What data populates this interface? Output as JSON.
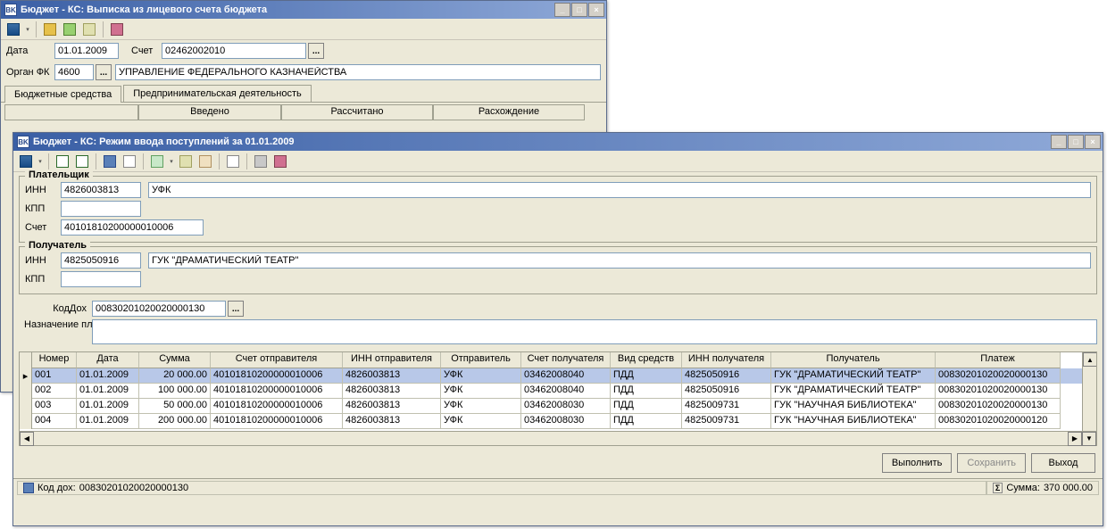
{
  "win1": {
    "title": "Бюджет - КС: Выписка из лицевого счета бюджета",
    "labels": {
      "date": "Дата",
      "account": "Счет",
      "organfk": "Орган ФК"
    },
    "date": "01.01.2009",
    "account": "02462002010",
    "organfk_code": "4600",
    "organfk_name": "УПРАВЛЕНИЕ ФЕДЕРАЛЬНОГО КАЗНАЧЕЙСТВА",
    "tabs": {
      "t1": "Бюджетные средства",
      "t2": "Предпринимательская деятельность"
    },
    "grid": {
      "c1": "",
      "c2": "Введено",
      "c3": "Рассчитано",
      "c4": "Расхождение"
    }
  },
  "win2": {
    "title": "Бюджет - КС: Режим ввода поступлений за 01.01.2009",
    "group1": {
      "legend": "Плательщик",
      "labels": {
        "inn": "ИНН",
        "kpp": "КПП",
        "acc": "Счет"
      },
      "inn": "4826003813",
      "kpp": "",
      "name": "УФК",
      "acc": "40101810200000010006"
    },
    "group2": {
      "legend": "Получатель",
      "labels": {
        "inn": "ИНН",
        "kpp": "КПП"
      },
      "inn": "4825050916",
      "kpp": "",
      "name": "ГУК \"ДРАМАТИЧЕСКИЙ ТЕАТР\""
    },
    "koddoh_label": "КодДох",
    "koddoh": "00830201020020000130",
    "nazn_label": "Назначение платежа",
    "nazn": "",
    "headers": {
      "num": "Номер",
      "date": "Дата",
      "sum": "Сумма",
      "sacc": "Счет отправителя",
      "sinn": "ИНН отправителя",
      "sender": "Отправитель",
      "racc": "Счет получателя",
      "vid": "Вид средств",
      "rinn": "ИНН получателя",
      "recv": "Получатель",
      "pay": "Платеж"
    },
    "rows": [
      {
        "num": "001",
        "date": "01.01.2009",
        "sum": "20 000.00",
        "sacc": "40101810200000010006",
        "sinn": "4826003813",
        "sender": "УФК",
        "racc": "03462008040",
        "vid": "ПДД",
        "rinn": "4825050916",
        "recv": "ГУК \"ДРАМАТИЧЕСКИЙ ТЕАТР\"",
        "pay": "00830201020020000130"
      },
      {
        "num": "002",
        "date": "01.01.2009",
        "sum": "100 000.00",
        "sacc": "40101810200000010006",
        "sinn": "4826003813",
        "sender": "УФК",
        "racc": "03462008040",
        "vid": "ПДД",
        "rinn": "4825050916",
        "recv": "ГУК \"ДРАМАТИЧЕСКИЙ ТЕАТР\"",
        "pay": "00830201020020000130"
      },
      {
        "num": "003",
        "date": "01.01.2009",
        "sum": "50 000.00",
        "sacc": "40101810200000010006",
        "sinn": "4826003813",
        "sender": "УФК",
        "racc": "03462008030",
        "vid": "ПДД",
        "rinn": "4825009731",
        "recv": "ГУК \"НАУЧНАЯ БИБЛИОТЕКА\"",
        "pay": "00830201020020000130"
      },
      {
        "num": "004",
        "date": "01.01.2009",
        "sum": "200 000.00",
        "sacc": "40101810200000010006",
        "sinn": "4826003813",
        "sender": "УФК",
        "racc": "03462008030",
        "vid": "ПДД",
        "rinn": "4825009731",
        "recv": "ГУК \"НАУЧНАЯ БИБЛИОТЕКА\"",
        "pay": "00830201020020000120"
      }
    ],
    "buttons": {
      "exec": "Выполнить",
      "save": "Сохранить",
      "exit": "Выход"
    },
    "status": {
      "koddoh_label": "Код дох:",
      "koddoh": "00830201020020000130",
      "sum_label": "Сумма:",
      "sum": "370 000.00"
    }
  },
  "winbtn": {
    "min": "_",
    "max": "□",
    "close": "×"
  }
}
